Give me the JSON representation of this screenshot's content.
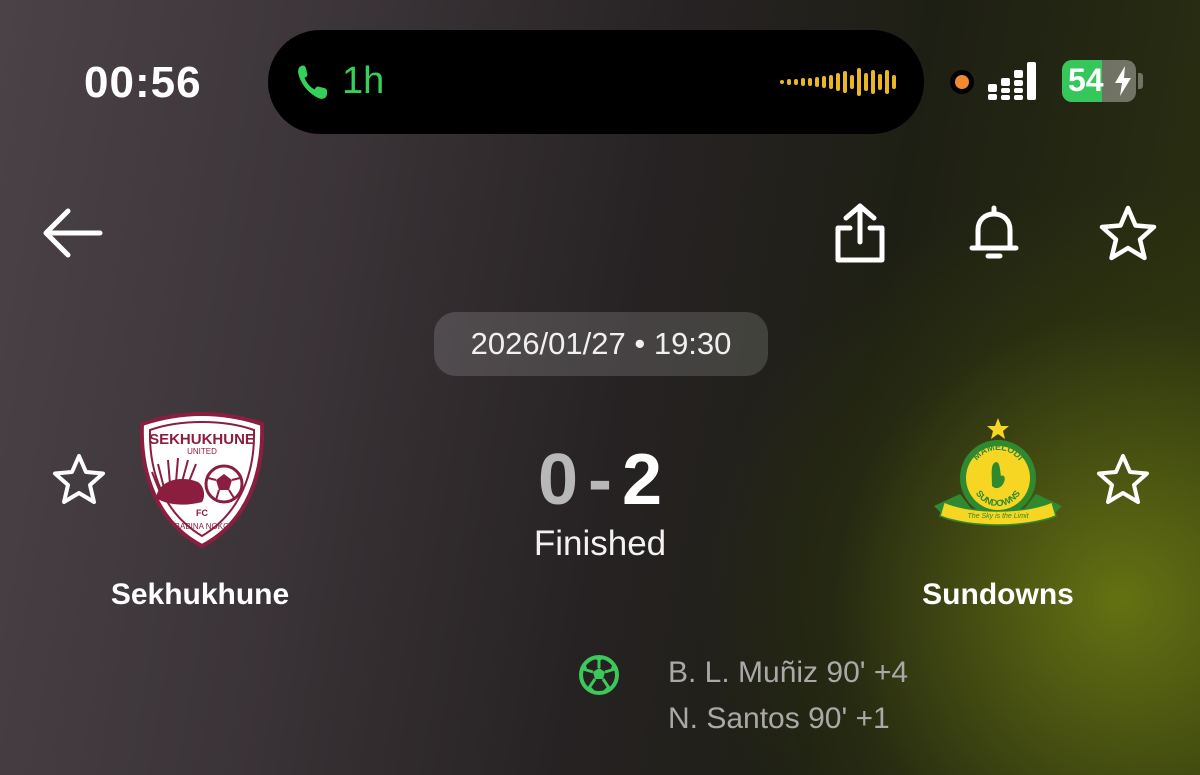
{
  "status_bar": {
    "time": "00:56",
    "call_duration": "1h",
    "battery_percent": "54",
    "battery_level": 0.54
  },
  "header": {
    "back_icon": "arrow-left-icon",
    "share_icon": "share-icon",
    "bell_icon": "bell-icon",
    "favorite_icon": "star-outline-icon"
  },
  "match": {
    "datetime": "2026/01/27 • 19:30",
    "home_team": {
      "name": "Sekhukhune",
      "logo_text_top": "SEKHUKHUNE",
      "logo_text_sub": "UNITED",
      "logo_text_fc": "FC",
      "logo_text_bottom": "BABINA NOKO",
      "color": "#8b1e3f"
    },
    "away_team": {
      "name": "Sundowns",
      "logo_text_top": "MAMELODI",
      "logo_text_bottom": "SUNDOWNS",
      "logo_banner": "The Sky is the Limit",
      "color": "#f6d623"
    },
    "home_score": "0",
    "separator": "-",
    "away_score": "2",
    "status": "Finished",
    "scorers": [
      {
        "text": "B. L. Muñiz 90' +4"
      },
      {
        "text": "N. Santos 90' +1"
      }
    ]
  },
  "colors": {
    "accent_green": "#35d05a",
    "goal_icon_green": "#3cc85a",
    "waveform": "#e9b626"
  }
}
